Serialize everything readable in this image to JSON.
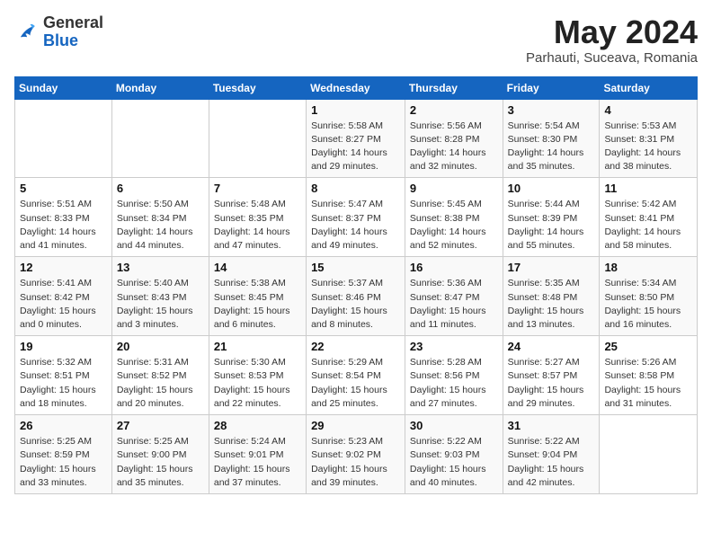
{
  "header": {
    "logo_general": "General",
    "logo_blue": "Blue",
    "month": "May 2024",
    "location": "Parhauti, Suceava, Romania"
  },
  "weekdays": [
    "Sunday",
    "Monday",
    "Tuesday",
    "Wednesday",
    "Thursday",
    "Friday",
    "Saturday"
  ],
  "weeks": [
    [
      {
        "num": "",
        "sunrise": "",
        "sunset": "",
        "daylight": ""
      },
      {
        "num": "",
        "sunrise": "",
        "sunset": "",
        "daylight": ""
      },
      {
        "num": "",
        "sunrise": "",
        "sunset": "",
        "daylight": ""
      },
      {
        "num": "1",
        "sunrise": "Sunrise: 5:58 AM",
        "sunset": "Sunset: 8:27 PM",
        "daylight": "Daylight: 14 hours and 29 minutes."
      },
      {
        "num": "2",
        "sunrise": "Sunrise: 5:56 AM",
        "sunset": "Sunset: 8:28 PM",
        "daylight": "Daylight: 14 hours and 32 minutes."
      },
      {
        "num": "3",
        "sunrise": "Sunrise: 5:54 AM",
        "sunset": "Sunset: 8:30 PM",
        "daylight": "Daylight: 14 hours and 35 minutes."
      },
      {
        "num": "4",
        "sunrise": "Sunrise: 5:53 AM",
        "sunset": "Sunset: 8:31 PM",
        "daylight": "Daylight: 14 hours and 38 minutes."
      }
    ],
    [
      {
        "num": "5",
        "sunrise": "Sunrise: 5:51 AM",
        "sunset": "Sunset: 8:33 PM",
        "daylight": "Daylight: 14 hours and 41 minutes."
      },
      {
        "num": "6",
        "sunrise": "Sunrise: 5:50 AM",
        "sunset": "Sunset: 8:34 PM",
        "daylight": "Daylight: 14 hours and 44 minutes."
      },
      {
        "num": "7",
        "sunrise": "Sunrise: 5:48 AM",
        "sunset": "Sunset: 8:35 PM",
        "daylight": "Daylight: 14 hours and 47 minutes."
      },
      {
        "num": "8",
        "sunrise": "Sunrise: 5:47 AM",
        "sunset": "Sunset: 8:37 PM",
        "daylight": "Daylight: 14 hours and 49 minutes."
      },
      {
        "num": "9",
        "sunrise": "Sunrise: 5:45 AM",
        "sunset": "Sunset: 8:38 PM",
        "daylight": "Daylight: 14 hours and 52 minutes."
      },
      {
        "num": "10",
        "sunrise": "Sunrise: 5:44 AM",
        "sunset": "Sunset: 8:39 PM",
        "daylight": "Daylight: 14 hours and 55 minutes."
      },
      {
        "num": "11",
        "sunrise": "Sunrise: 5:42 AM",
        "sunset": "Sunset: 8:41 PM",
        "daylight": "Daylight: 14 hours and 58 minutes."
      }
    ],
    [
      {
        "num": "12",
        "sunrise": "Sunrise: 5:41 AM",
        "sunset": "Sunset: 8:42 PM",
        "daylight": "Daylight: 15 hours and 0 minutes."
      },
      {
        "num": "13",
        "sunrise": "Sunrise: 5:40 AM",
        "sunset": "Sunset: 8:43 PM",
        "daylight": "Daylight: 15 hours and 3 minutes."
      },
      {
        "num": "14",
        "sunrise": "Sunrise: 5:38 AM",
        "sunset": "Sunset: 8:45 PM",
        "daylight": "Daylight: 15 hours and 6 minutes."
      },
      {
        "num": "15",
        "sunrise": "Sunrise: 5:37 AM",
        "sunset": "Sunset: 8:46 PM",
        "daylight": "Daylight: 15 hours and 8 minutes."
      },
      {
        "num": "16",
        "sunrise": "Sunrise: 5:36 AM",
        "sunset": "Sunset: 8:47 PM",
        "daylight": "Daylight: 15 hours and 11 minutes."
      },
      {
        "num": "17",
        "sunrise": "Sunrise: 5:35 AM",
        "sunset": "Sunset: 8:48 PM",
        "daylight": "Daylight: 15 hours and 13 minutes."
      },
      {
        "num": "18",
        "sunrise": "Sunrise: 5:34 AM",
        "sunset": "Sunset: 8:50 PM",
        "daylight": "Daylight: 15 hours and 16 minutes."
      }
    ],
    [
      {
        "num": "19",
        "sunrise": "Sunrise: 5:32 AM",
        "sunset": "Sunset: 8:51 PM",
        "daylight": "Daylight: 15 hours and 18 minutes."
      },
      {
        "num": "20",
        "sunrise": "Sunrise: 5:31 AM",
        "sunset": "Sunset: 8:52 PM",
        "daylight": "Daylight: 15 hours and 20 minutes."
      },
      {
        "num": "21",
        "sunrise": "Sunrise: 5:30 AM",
        "sunset": "Sunset: 8:53 PM",
        "daylight": "Daylight: 15 hours and 22 minutes."
      },
      {
        "num": "22",
        "sunrise": "Sunrise: 5:29 AM",
        "sunset": "Sunset: 8:54 PM",
        "daylight": "Daylight: 15 hours and 25 minutes."
      },
      {
        "num": "23",
        "sunrise": "Sunrise: 5:28 AM",
        "sunset": "Sunset: 8:56 PM",
        "daylight": "Daylight: 15 hours and 27 minutes."
      },
      {
        "num": "24",
        "sunrise": "Sunrise: 5:27 AM",
        "sunset": "Sunset: 8:57 PM",
        "daylight": "Daylight: 15 hours and 29 minutes."
      },
      {
        "num": "25",
        "sunrise": "Sunrise: 5:26 AM",
        "sunset": "Sunset: 8:58 PM",
        "daylight": "Daylight: 15 hours and 31 minutes."
      }
    ],
    [
      {
        "num": "26",
        "sunrise": "Sunrise: 5:25 AM",
        "sunset": "Sunset: 8:59 PM",
        "daylight": "Daylight: 15 hours and 33 minutes."
      },
      {
        "num": "27",
        "sunrise": "Sunrise: 5:25 AM",
        "sunset": "Sunset: 9:00 PM",
        "daylight": "Daylight: 15 hours and 35 minutes."
      },
      {
        "num": "28",
        "sunrise": "Sunrise: 5:24 AM",
        "sunset": "Sunset: 9:01 PM",
        "daylight": "Daylight: 15 hours and 37 minutes."
      },
      {
        "num": "29",
        "sunrise": "Sunrise: 5:23 AM",
        "sunset": "Sunset: 9:02 PM",
        "daylight": "Daylight: 15 hours and 39 minutes."
      },
      {
        "num": "30",
        "sunrise": "Sunrise: 5:22 AM",
        "sunset": "Sunset: 9:03 PM",
        "daylight": "Daylight: 15 hours and 40 minutes."
      },
      {
        "num": "31",
        "sunrise": "Sunrise: 5:22 AM",
        "sunset": "Sunset: 9:04 PM",
        "daylight": "Daylight: 15 hours and 42 minutes."
      },
      {
        "num": "",
        "sunrise": "",
        "sunset": "",
        "daylight": ""
      }
    ]
  ]
}
